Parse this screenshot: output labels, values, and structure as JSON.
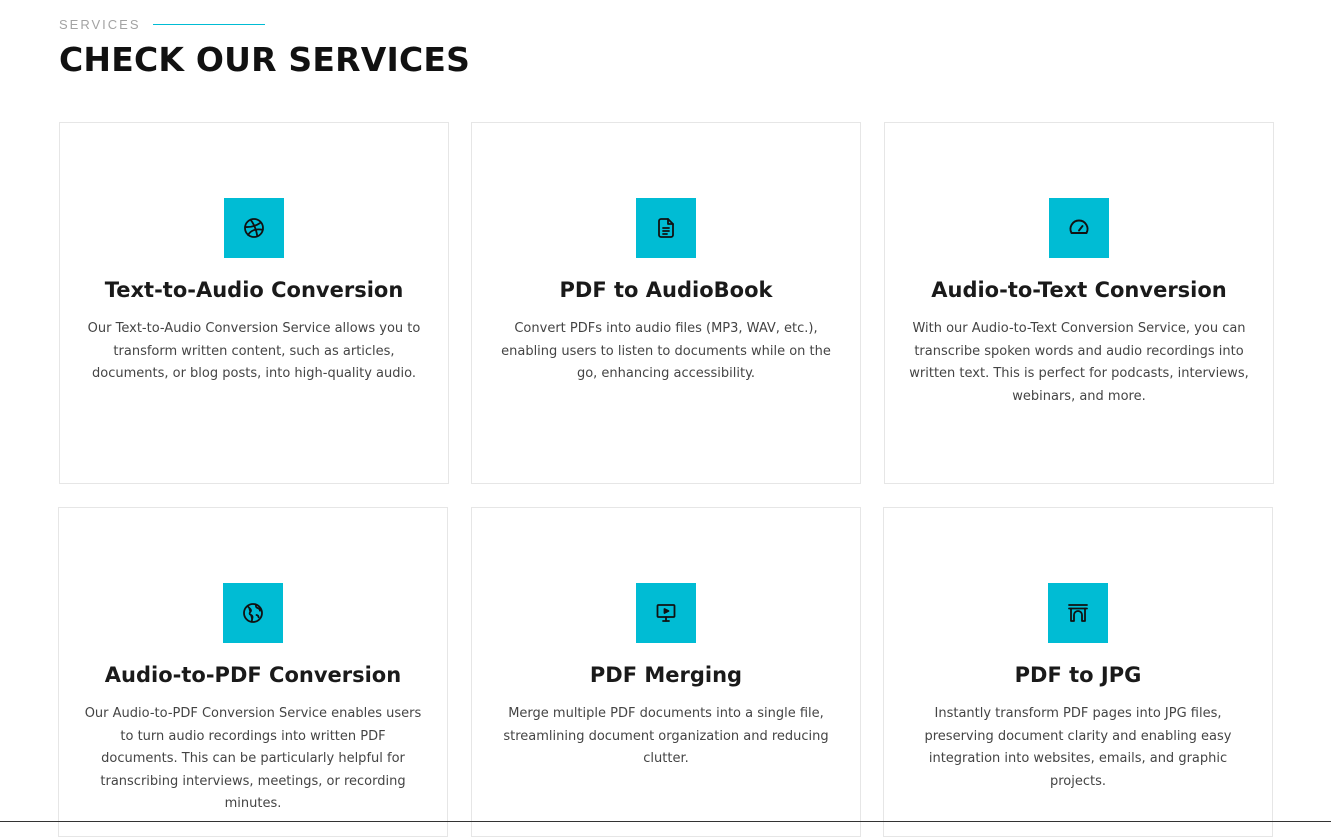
{
  "section": {
    "eyebrow": "SERVICES",
    "title": "CHECK OUR SERVICES"
  },
  "colors": {
    "accent": "#00bcd4",
    "card_border": "#e6e6e6",
    "title": "#111111",
    "text": "#444444"
  },
  "services": [
    {
      "icon": "dribbble-icon",
      "title": "Text-to-Audio Conversion",
      "description": "Our Text-to-Audio Conversion Service allows you to transform written content, such as articles, documents, or blog posts, into high-quality audio."
    },
    {
      "icon": "document-icon",
      "title": "PDF to AudioBook",
      "description": "Convert PDFs into audio files (MP3, WAV, etc.), enabling users to listen to documents while on the go, enhancing accessibility."
    },
    {
      "icon": "speedometer-icon",
      "title": "Audio-to-Text Conversion",
      "description": "With our Audio-to-Text Conversion Service, you can transcribe spoken words and audio recordings into written text. This is perfect for podcasts, interviews, webinars, and more."
    },
    {
      "icon": "globe-icon",
      "title": "Audio-to-PDF Conversion",
      "description": "Our Audio-to-PDF Conversion Service enables users to turn audio recordings into written PDF documents. This can be particularly helpful for transcribing interviews, meetings, or recording minutes."
    },
    {
      "icon": "presentation-icon",
      "title": "PDF Merging",
      "description": "Merge multiple PDF documents into a single file, streamlining document organization and reducing clutter."
    },
    {
      "icon": "archway-icon",
      "title": "PDF to JPG",
      "description": "Instantly transform PDF pages into JPG files, preserving document clarity and enabling easy integration into websites, emails, and graphic projects."
    }
  ]
}
